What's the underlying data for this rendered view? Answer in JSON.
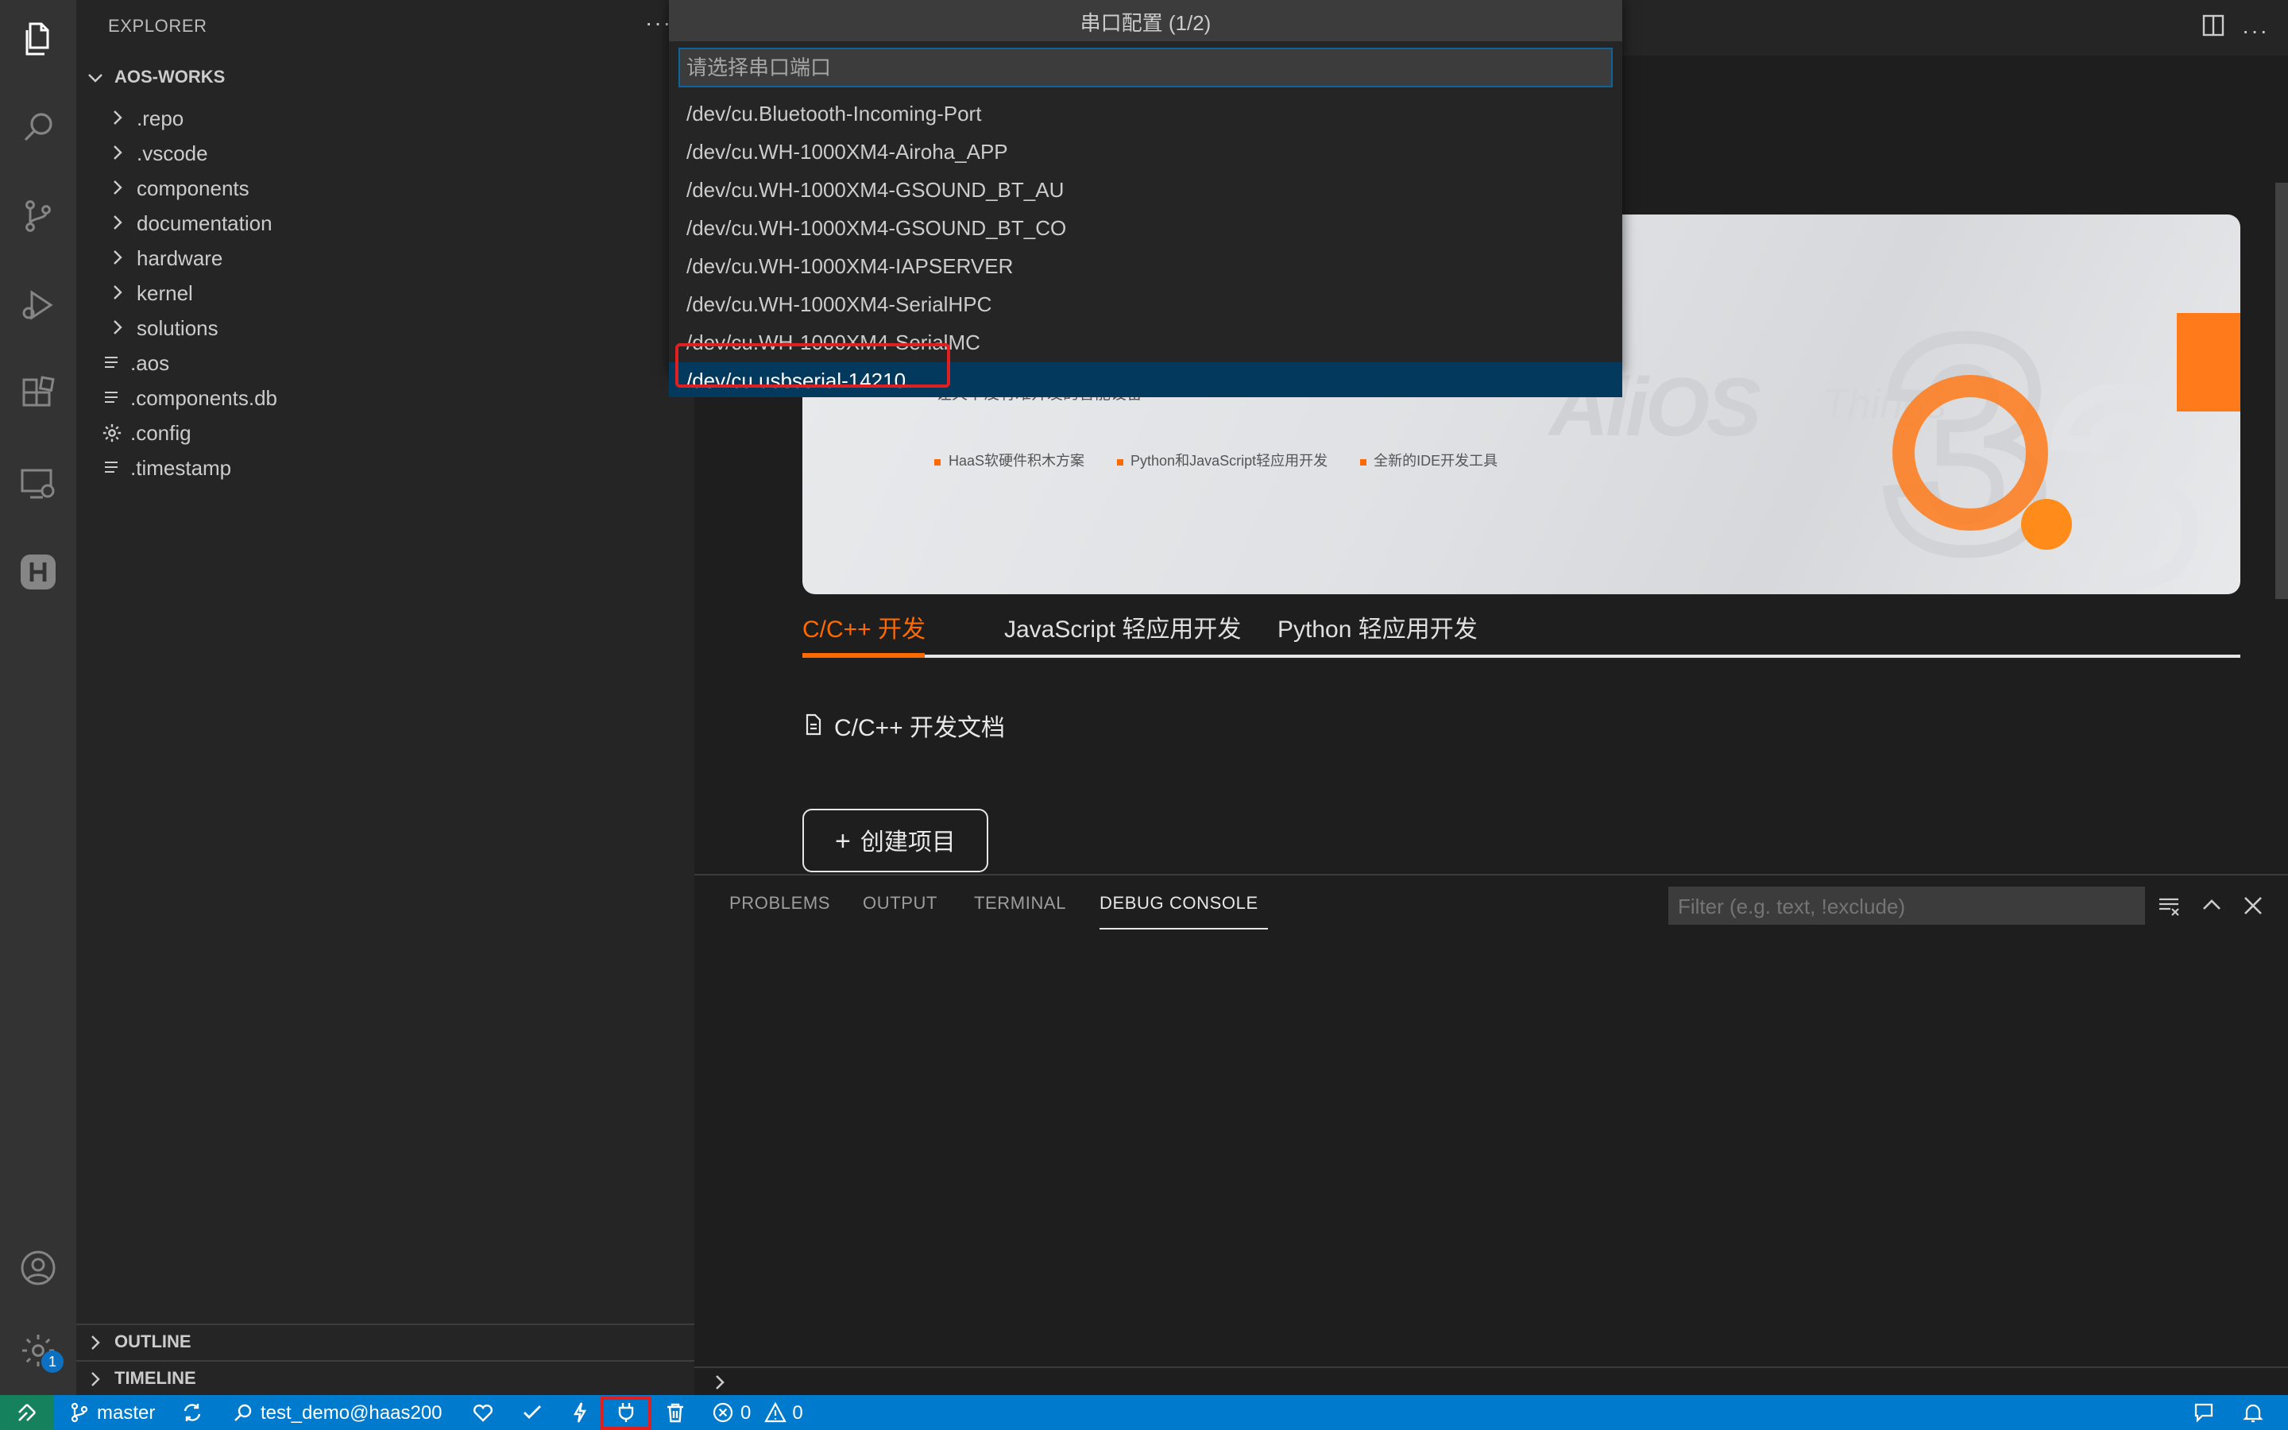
{
  "sidebar": {
    "header": "EXPLORER",
    "more": "···",
    "folder": "AOS-WORKS",
    "items": [
      {
        "label": ".repo",
        "kind": "folder"
      },
      {
        "label": ".vscode",
        "kind": "folder"
      },
      {
        "label": "components",
        "kind": "folder"
      },
      {
        "label": "documentation",
        "kind": "folder"
      },
      {
        "label": "hardware",
        "kind": "folder"
      },
      {
        "label": "kernel",
        "kind": "folder"
      },
      {
        "label": "solutions",
        "kind": "folder"
      },
      {
        "label": ".aos",
        "kind": "file"
      },
      {
        "label": ".components.db",
        "kind": "file"
      },
      {
        "label": ".config",
        "kind": "gear-file"
      },
      {
        "label": ".timestamp",
        "kind": "file"
      }
    ],
    "outline": "OUTLINE",
    "timeline": "TIMELINE"
  },
  "activity": {
    "icons": [
      "files-icon",
      "search-icon",
      "source-control-icon",
      "run-debug-icon",
      "extensions-icon",
      "remote-explorer-icon",
      "haas-icon"
    ],
    "account_icon": "account-icon",
    "settings_icon": "gear-icon",
    "settings_badge": "1"
  },
  "quickpick": {
    "title": "串口配置 (1/2)",
    "placeholder": "请选择串口端口",
    "items": [
      "/dev/cu.Bluetooth-Incoming-Port",
      "/dev/cu.WH-1000XM4-Airoha_APP",
      "/dev/cu.WH-1000XM4-GSOUND_BT_AU",
      "/dev/cu.WH-1000XM4-GSOUND_BT_CO",
      "/dev/cu.WH-1000XM4-IAPSERVER",
      "/dev/cu.WH-1000XM4-SerialHPC",
      "/dev/cu.WH-1000XM4-SerialMC",
      "/dev/cu.usbserial-14210"
    ],
    "selected_index": 7
  },
  "banner": {
    "slogan": "让天下没有难开发的智能设备",
    "bullets": [
      "HaaS软硬件积木方案",
      "Python和JavaScript轻应用开发",
      "全新的IDE开发工具"
    ],
    "brand": "AliOS",
    "brand_sub": "Things",
    "version": "3.3",
    "accent": "#ff6a00"
  },
  "tabs": [
    "C/C++ 开发",
    "JavaScript 轻应用开发",
    "Python 轻应用开发"
  ],
  "active_tab": 0,
  "doc_link": "C/C++ 开发文档",
  "create_button": "创建项目",
  "panel": {
    "tabs": [
      "PROBLEMS",
      "OUTPUT",
      "TERMINAL",
      "DEBUG CONSOLE"
    ],
    "active_tab": 3,
    "filter_placeholder": "Filter (e.g. text, !exclude)"
  },
  "statusbar": {
    "branch": "master",
    "user": "test_demo@haas200",
    "errors": "0",
    "warnings": "0",
    "color": "#007acc"
  }
}
